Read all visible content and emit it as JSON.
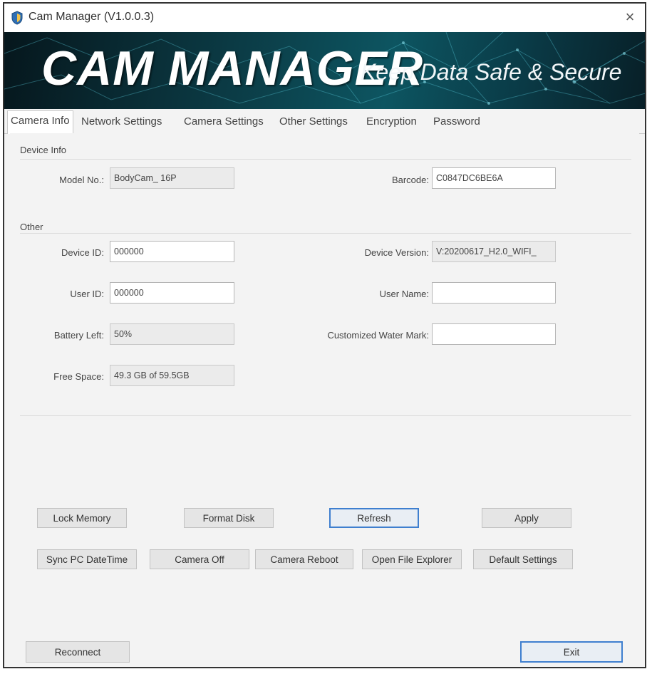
{
  "window": {
    "title": "Cam Manager (V1.0.0.3)",
    "close_glyph": "×",
    "icon": "shield-icon"
  },
  "banner": {
    "logo": "CAM MANAGER",
    "tagline": "Keep Data Safe & Secure"
  },
  "tabs": [
    {
      "label": "Camera Info",
      "active": true
    },
    {
      "label": "Network Settings",
      "active": false
    },
    {
      "label": "Camera Settings",
      "active": false
    },
    {
      "label": "Other Settings",
      "active": false
    },
    {
      "label": "Encryption",
      "active": false
    },
    {
      "label": "Password",
      "active": false
    }
  ],
  "device_info": {
    "title": "Device Info",
    "model_label": "Model No.:",
    "model_value": "BodyCam_ 16P",
    "barcode_label": "Barcode:",
    "barcode_value": "C0847DC6BE6A"
  },
  "other": {
    "title": "Other",
    "device_id_label": "Device ID:",
    "device_id_value": "000000",
    "device_version_label": "Device Version:",
    "device_version_value": "V:20200617_H2.0_WIFI_",
    "user_id_label": "User ID:",
    "user_id_value": "000000",
    "user_name_label": "User Name:",
    "user_name_value": "",
    "battery_label": "Battery Left:",
    "battery_value": "50%",
    "watermark_label": "Customized Water Mark:",
    "watermark_value": "",
    "free_space_label": "Free Space:",
    "free_space_value": "49.3 GB of 59.5GB"
  },
  "buttons": {
    "lock_memory": "Lock Memory",
    "format_disk": "Format Disk",
    "refresh": "Refresh",
    "apply": "Apply",
    "sync_pc_datetime": "Sync PC DateTime",
    "camera_off": "Camera Off",
    "camera_reboot": "Camera Reboot",
    "open_file_explorer": "Open File Explorer",
    "default_settings": "Default Settings",
    "reconnect": "Reconnect",
    "exit": "Exit"
  },
  "colors": {
    "accent": "#3f7fcf",
    "banner_dark": "#06171d",
    "banner_teal": "#0d5561"
  }
}
